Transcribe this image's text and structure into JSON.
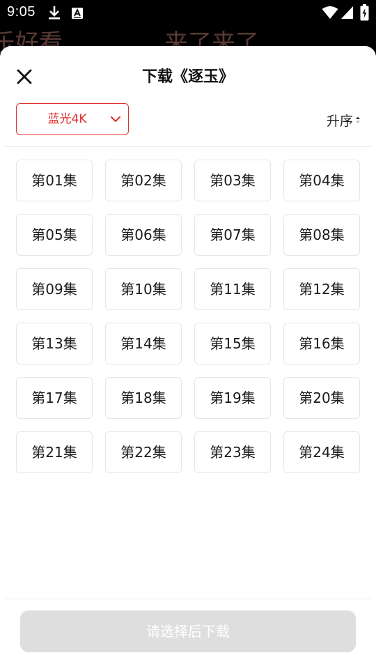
{
  "status_bar": {
    "time": "9:05",
    "icons": [
      "download-icon",
      "a-square-icon",
      "wifi-icon",
      "signal-icon",
      "battery-charging-icon"
    ]
  },
  "background": {
    "left_text": "乐好看",
    "right_text": "来了来了"
  },
  "sheet": {
    "title": "下载《逐玉》",
    "close_icon": "close-icon"
  },
  "quality": {
    "selected": "蓝光4K",
    "icon": "chevron-down-icon"
  },
  "sort": {
    "label": "升序",
    "icon": "sort-caret-icon"
  },
  "episodes": [
    "第01集",
    "第02集",
    "第03集",
    "第04集",
    "第05集",
    "第06集",
    "第07集",
    "第08集",
    "第09集",
    "第10集",
    "第11集",
    "第12集",
    "第13集",
    "第14集",
    "第15集",
    "第16集",
    "第17集",
    "第18集",
    "第19集",
    "第20集",
    "第21集",
    "第22集",
    "第23集",
    "第24集"
  ],
  "footer": {
    "download_label": "请选择后下载"
  },
  "colors": {
    "accent": "#e0302c",
    "button_disabled_bg": "#dedede",
    "episode_border": "#e6e6e6"
  }
}
